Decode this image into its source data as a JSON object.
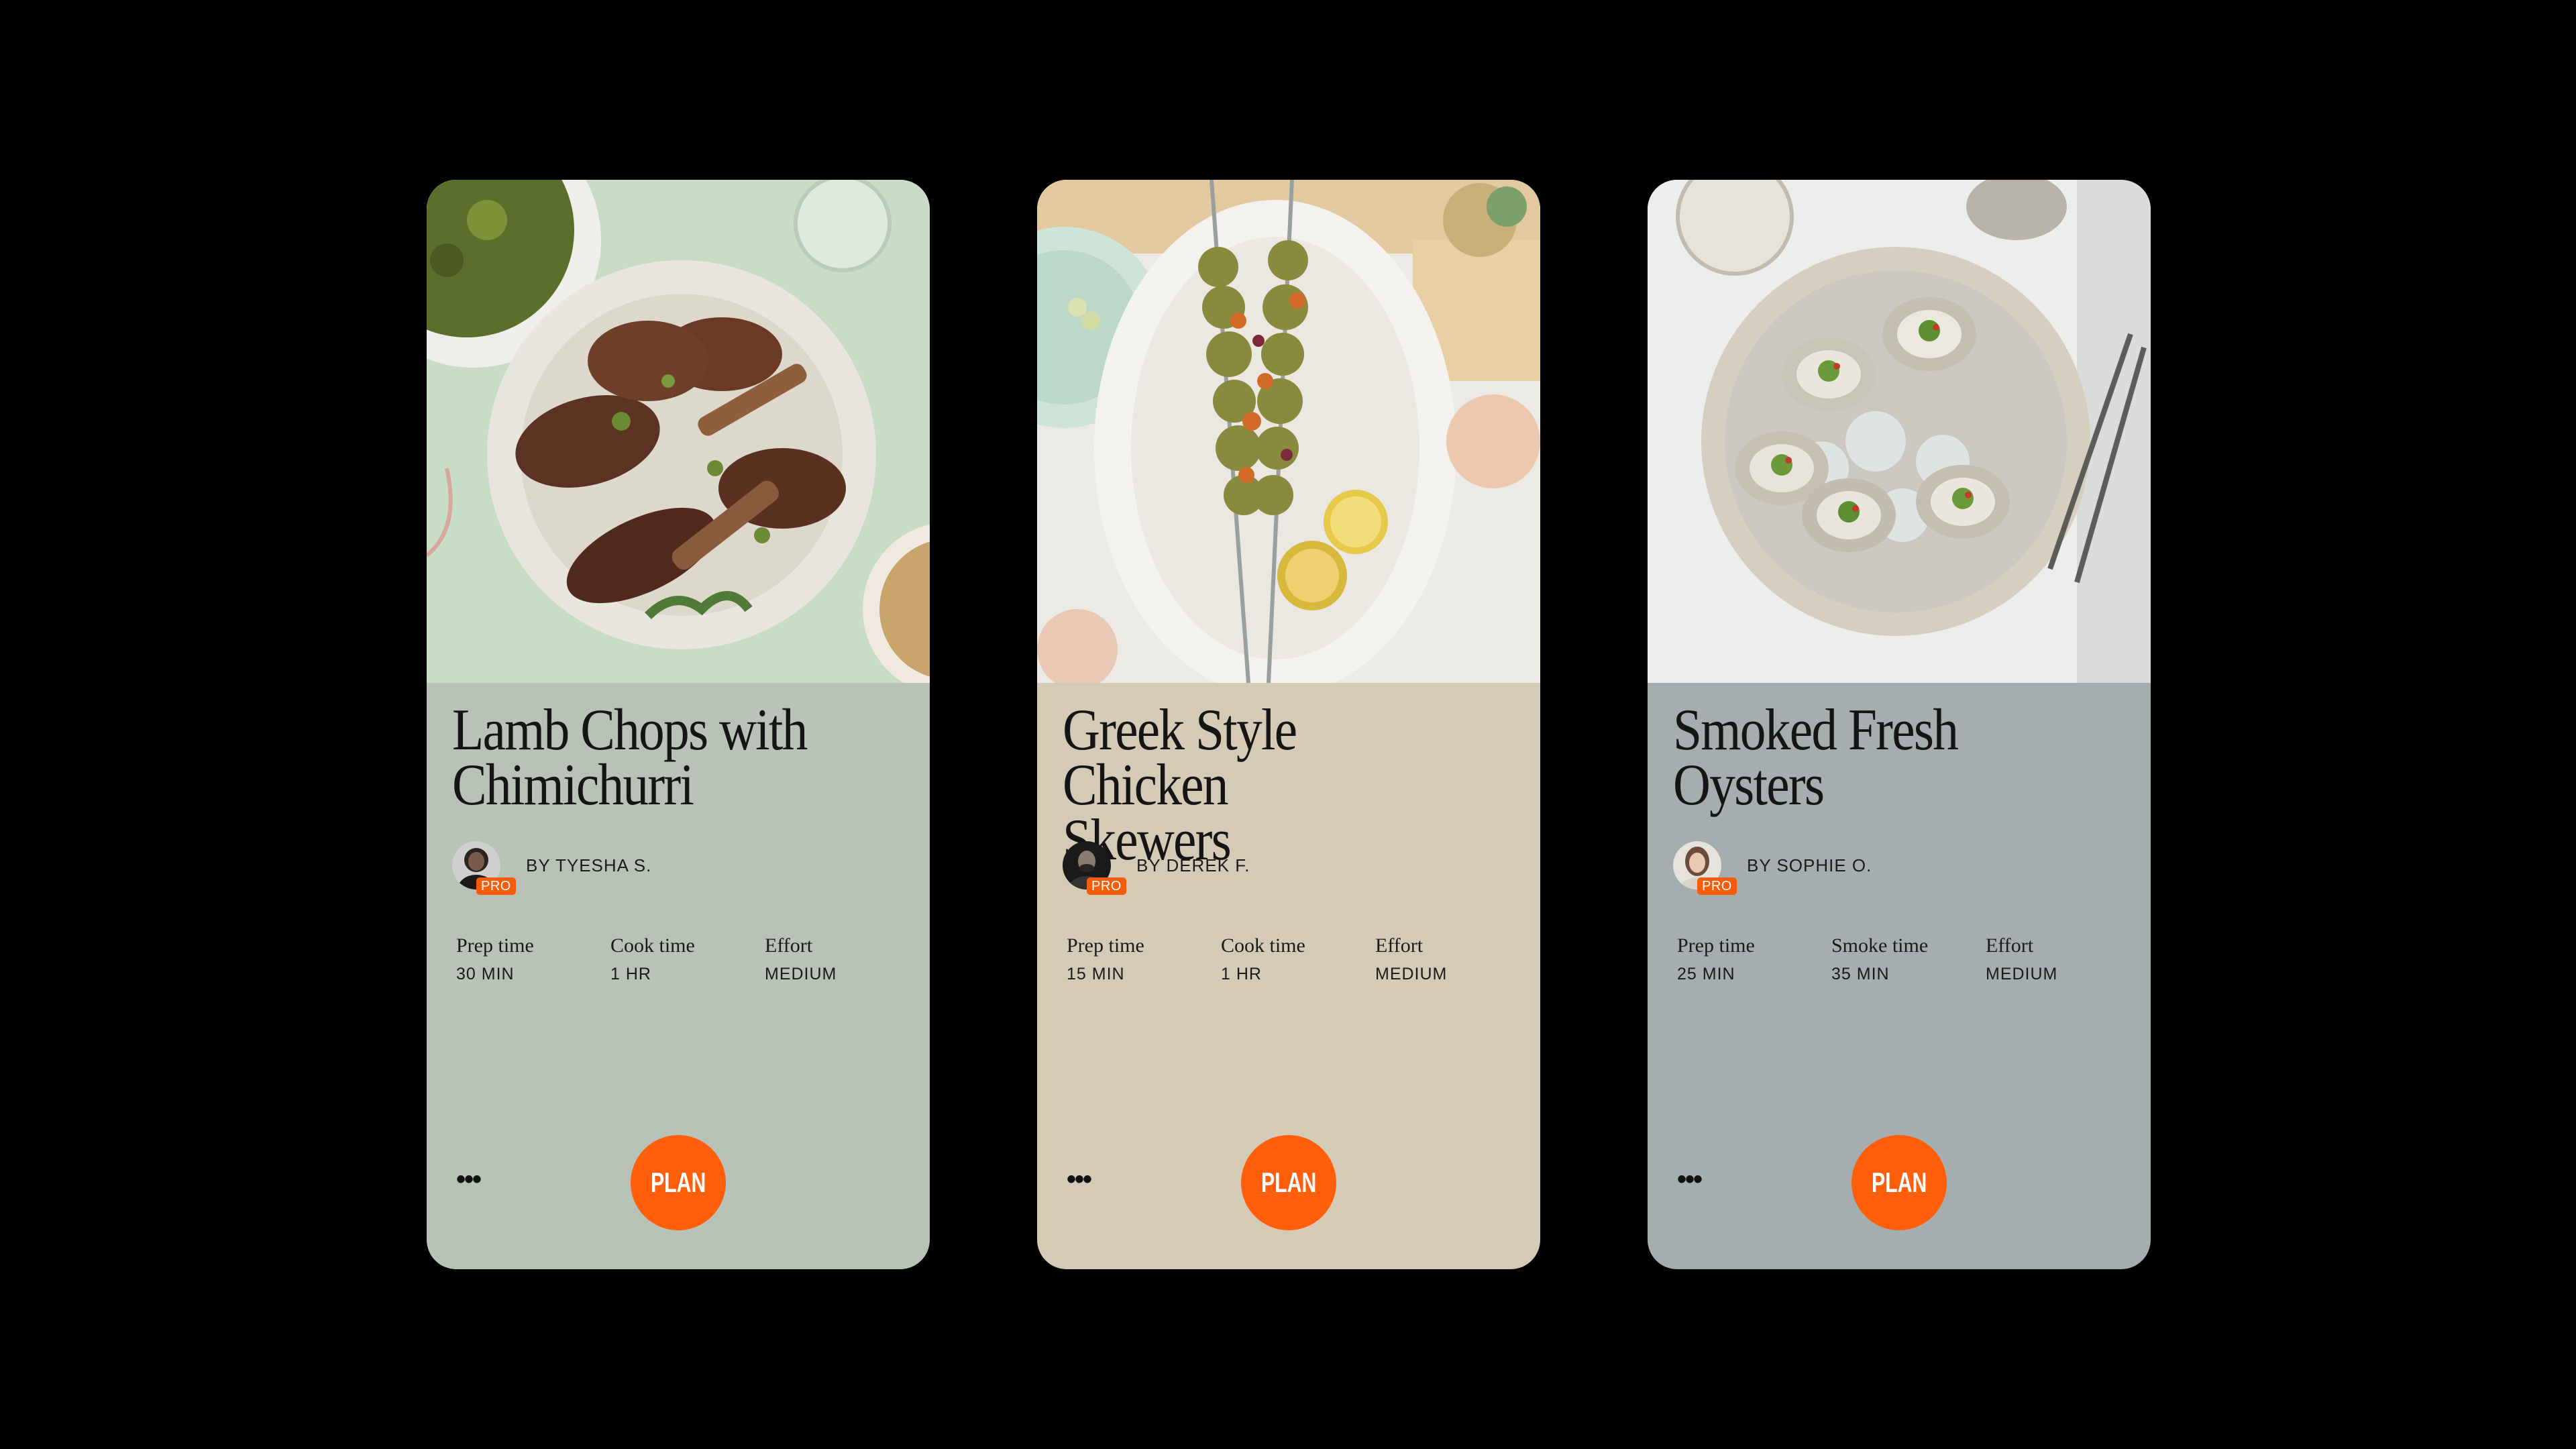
{
  "cards": [
    {
      "title_line1": "Lamb Chops with",
      "title_line2": "Chimichurri",
      "author": "BY TYESHA S.",
      "badge": "PRO",
      "stats": [
        {
          "label": "Prep time",
          "value": "30 MIN"
        },
        {
          "label": "Cook time",
          "value": "1 HR"
        },
        {
          "label": "Effort",
          "value": "MEDIUM"
        }
      ],
      "more": "•••",
      "action": "PLAN",
      "background": "#b8c2b7"
    },
    {
      "title_line1": "Greek Style Chicken",
      "title_line2": "Skewers",
      "author": "BY DEREK F.",
      "badge": "PRO",
      "stats": [
        {
          "label": "Prep time",
          "value": "15 MIN"
        },
        {
          "label": "Cook time",
          "value": "1 HR"
        },
        {
          "label": "Effort",
          "value": "MEDIUM"
        }
      ],
      "more": "•••",
      "action": "PLAN",
      "background": "#d4cab6"
    },
    {
      "title_line1": "Smoked Fresh",
      "title_line2": "Oysters",
      "author": "BY SOPHIE O.",
      "badge": "PRO",
      "stats": [
        {
          "label": "Prep time",
          "value": "25 MIN"
        },
        {
          "label": "Smoke time",
          "value": "35 MIN"
        },
        {
          "label": "Effort",
          "value": "MEDIUM"
        }
      ],
      "more": "•••",
      "action": "PLAN",
      "background": "#a5adae"
    }
  ],
  "colors": {
    "accent": "#ff5e0a",
    "page_background": "#000000"
  }
}
